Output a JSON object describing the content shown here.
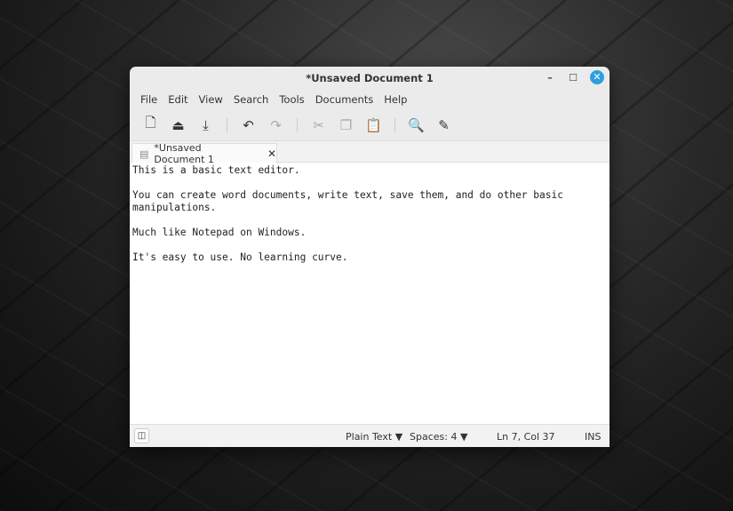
{
  "window": {
    "title": "*Unsaved Document 1",
    "minimize": "–",
    "maximize": "☐",
    "close": "✕"
  },
  "menu": [
    "File",
    "Edit",
    "View",
    "Search",
    "Tools",
    "Documents",
    "Help"
  ],
  "toolbar": {
    "new": "🗋",
    "open": "⏏",
    "save": "⤓",
    "undo": "↶",
    "redo": "↷",
    "cut": "✂",
    "copy": "❐",
    "paste": "📋",
    "find": "🔍",
    "replace": "✎"
  },
  "tab": {
    "label": "*Unsaved Document 1",
    "icon": "▤",
    "close": "✕"
  },
  "editor": {
    "text": "This is a basic text editor.\n\nYou can create word documents, write text, save them, and do other basic\nmanipulations.\n\nMuch like Notepad on Windows.\n\nIt's easy to use. No learning curve."
  },
  "status": {
    "sidepanel": "◫",
    "language": "Plain Text ▼",
    "spaces": "Spaces: 4 ▼",
    "position": "Ln 7, Col 37",
    "mode": "INS"
  }
}
